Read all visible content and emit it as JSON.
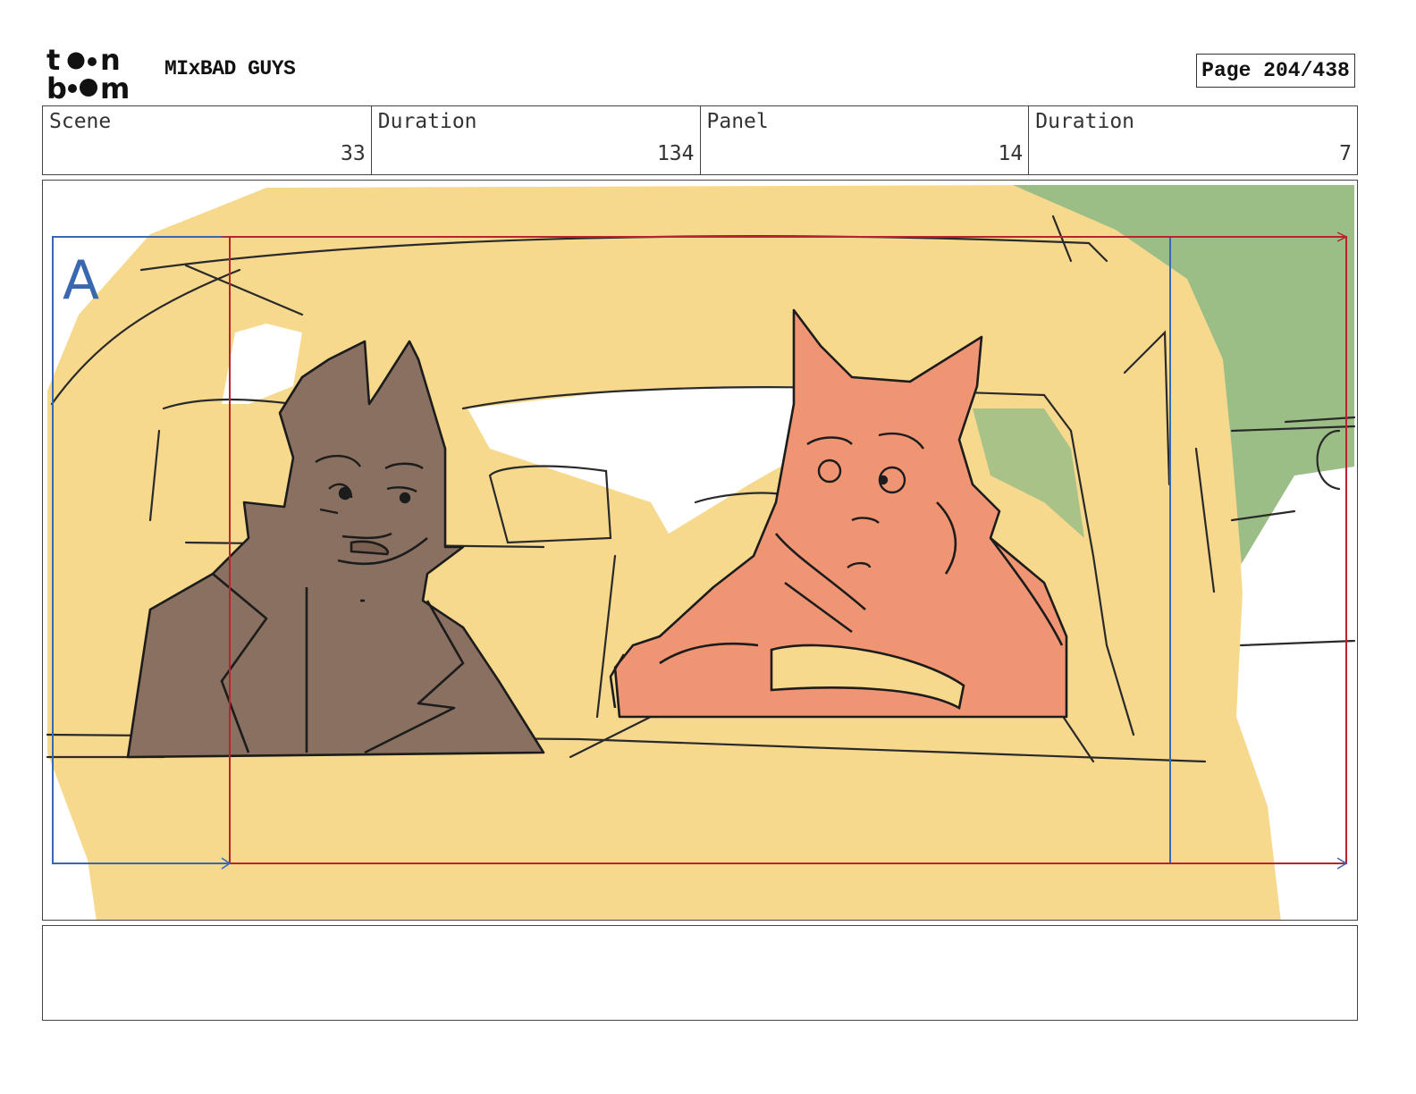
{
  "header": {
    "logo_text": "toon boom",
    "project_title": "MIxBAD GUYS",
    "page_indicator": "Page 204/438"
  },
  "info_row": [
    {
      "label": "Scene",
      "value": "33"
    },
    {
      "label": "Duration",
      "value": "134"
    },
    {
      "label": "Panel",
      "value": "14"
    },
    {
      "label": "Duration",
      "value": "7"
    }
  ],
  "panel": {
    "camera_label": "A",
    "colors": {
      "car_interior": "#f7d98e",
      "wolf_character": "#8a7060",
      "fox_character": "#ef9574",
      "foliage": "#9bbd86",
      "line_art": "#2a2a2a",
      "camera_frame_blue": "#3a68b0",
      "camera_frame_red": "#b8232c"
    }
  },
  "notes": {
    "text": ""
  }
}
